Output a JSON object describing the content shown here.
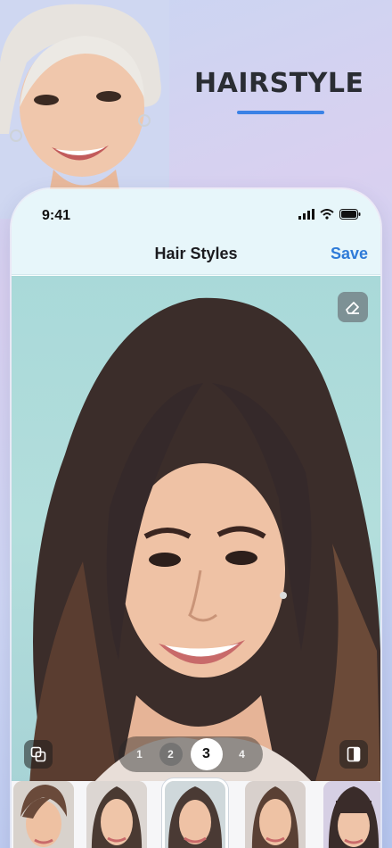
{
  "promo": {
    "title": "HAIRSTYLE"
  },
  "status_bar": {
    "time": "9:41"
  },
  "nav": {
    "title": "Hair Styles",
    "save_label": "Save"
  },
  "variants": {
    "items": [
      "1",
      "2",
      "3",
      "4"
    ],
    "selected": "3"
  },
  "thumbnails": {
    "count": 5,
    "selected_index": 2
  },
  "colors": {
    "accent": "#2f7bd8",
    "underline": "#3b82e6",
    "photo_bg": "#a9d9d9"
  }
}
